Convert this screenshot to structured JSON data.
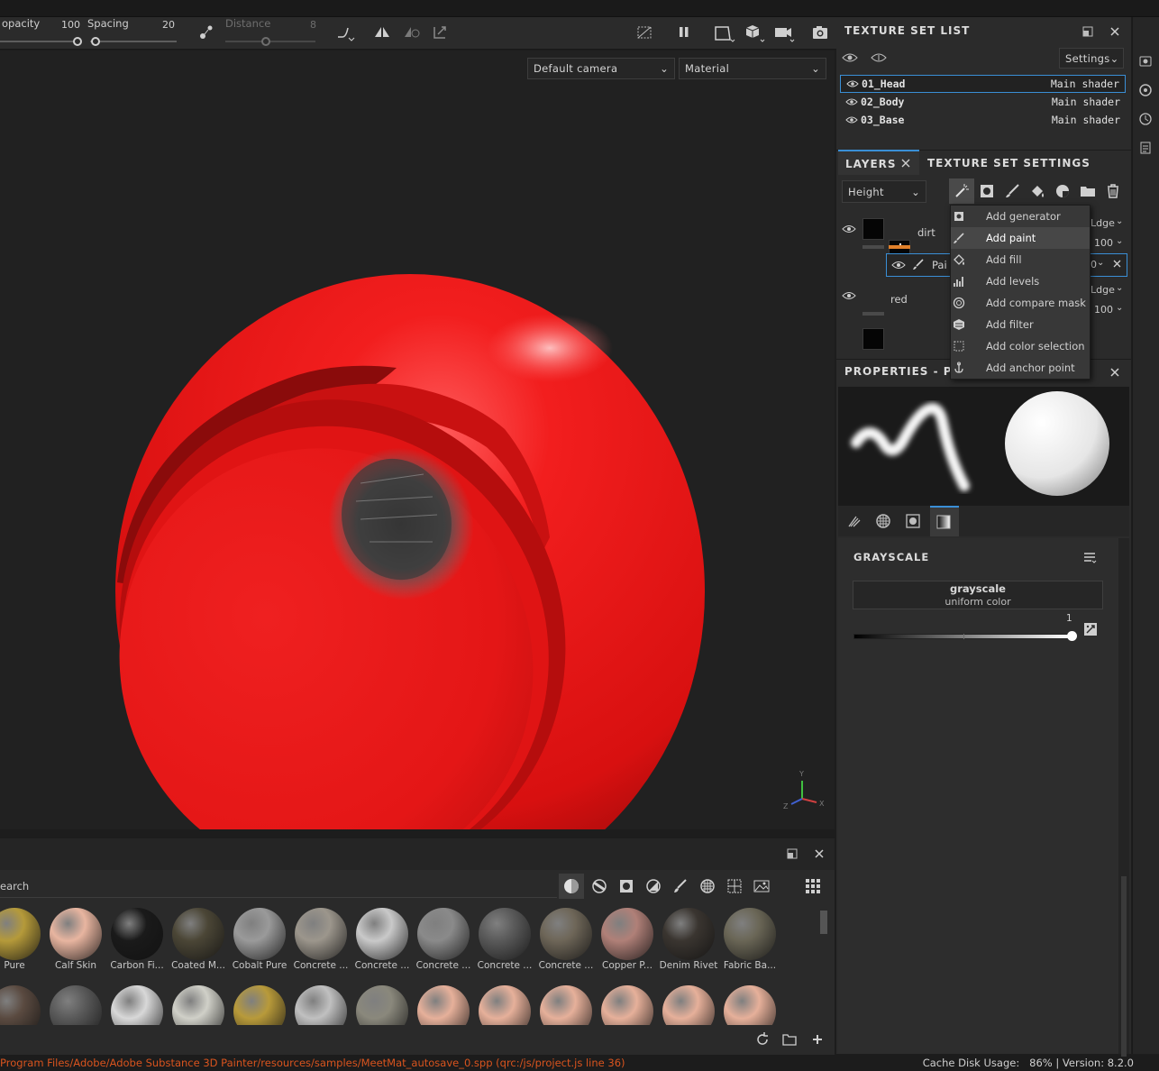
{
  "toolbar": {
    "opacity_label": "opacity",
    "opacity_value": "100",
    "opacity_fraction": 1.0,
    "spacing_label": "Spacing",
    "spacing_value": "20",
    "spacing_fraction": 0.0,
    "distance_label": "Distance",
    "distance_value": "8",
    "distance_fraction": 0.45
  },
  "viewport": {
    "camera_select": "Default camera",
    "mode_select": "Material",
    "gizmo": {
      "y": "Y",
      "x": "X",
      "z": "Z"
    },
    "colors": {
      "background": "#212121",
      "sphere": "#e31212"
    }
  },
  "shelf": {
    "search_placeholder": "earch",
    "materials_row1": [
      {
        "label": "Pure",
        "color": "#b59a3a"
      },
      {
        "label": "Calf Skin",
        "color": "#e8b5a0"
      },
      {
        "label": "Carbon Fi...",
        "color": "#1a1a1a"
      },
      {
        "label": "Coated M...",
        "color": "#4b4636"
      },
      {
        "label": "Cobalt Pure",
        "color": "#9a9a9a"
      },
      {
        "label": "Concrete ...",
        "color": "#9c968c"
      },
      {
        "label": "Concrete ...",
        "color": "#c9c9c9"
      },
      {
        "label": "Concrete ...",
        "color": "#8a8a8a"
      },
      {
        "label": "Concrete ...",
        "color": "#5a5a5a"
      },
      {
        "label": "Concrete ...",
        "color": "#6e6658"
      },
      {
        "label": "Copper P...",
        "color": "#b08078"
      },
      {
        "label": "Denim Rivet",
        "color": "#3a3530"
      },
      {
        "label": "Fabric Ba...",
        "color": "#6a6656"
      }
    ],
    "materials_row2": [
      {
        "color": "#5a4a40"
      },
      {
        "color": "#5a5a5a"
      },
      {
        "color": "#d8d8d8"
      },
      {
        "color": "#d0d0c8"
      },
      {
        "color": "#b89a3a"
      },
      {
        "color": "#c0c0c0"
      },
      {
        "color": "#8a887c"
      },
      {
        "color": "#e6b09a"
      },
      {
        "color": "#e6b09a"
      },
      {
        "color": "#e6b09a"
      },
      {
        "color": "#e6b09a"
      },
      {
        "color": "#e6b09a"
      },
      {
        "color": "#e6b09a"
      }
    ]
  },
  "status": {
    "path": "Program Files/Adobe/Adobe Substance 3D Painter/resources/samples/MeetMat_autosave_0.spp (qrc:/js/project.js line 36)",
    "cache": "Cache Disk Usage:   86% | Version: 8.2.0"
  },
  "texture_set_list": {
    "title": "TEXTURE SET LIST",
    "settings_label": "Settings",
    "items": [
      {
        "name": "01_Head",
        "shader": "Main shader",
        "selected": true
      },
      {
        "name": "02_Body",
        "shader": "Main shader",
        "selected": false
      },
      {
        "name": "03_Base",
        "shader": "Main shader",
        "selected": false
      }
    ]
  },
  "layers": {
    "tab_layers": "LAYERS",
    "tab_texture_set_settings": "TEXTURE SET SETTINGS",
    "channel_select": "Height",
    "items": [
      {
        "name": "dirt",
        "blend": "Ldge",
        "opacity": "100"
      },
      {
        "name": "Pai",
        "opacity": "0"
      },
      {
        "name": "red",
        "blend": "Ldge",
        "opacity": "100"
      }
    ],
    "accent_color": "#e0802a"
  },
  "add_menu": {
    "items": [
      {
        "label": "Add generator",
        "icon": "generator-icon",
        "highlighted": false
      },
      {
        "label": "Add paint",
        "icon": "brush-icon",
        "highlighted": true
      },
      {
        "label": "Add fill",
        "icon": "fill-bucket-icon",
        "highlighted": false
      },
      {
        "label": "Add levels",
        "icon": "levels-icon",
        "highlighted": false
      },
      {
        "label": "Add compare mask",
        "icon": "compare-mask-icon",
        "highlighted": false
      },
      {
        "label": "Add filter",
        "icon": "filter-icon",
        "highlighted": false
      },
      {
        "label": "Add color selection",
        "icon": "color-selection-icon",
        "highlighted": false
      },
      {
        "label": "Add anchor point",
        "icon": "anchor-icon",
        "highlighted": false
      }
    ]
  },
  "properties": {
    "title": "PROPERTIES - PA",
    "section_title": "GRAYSCALE",
    "grayscale_label": "grayscale",
    "grayscale_sub": "uniform color",
    "slider_value": "1",
    "slider_fraction": 1.0
  }
}
